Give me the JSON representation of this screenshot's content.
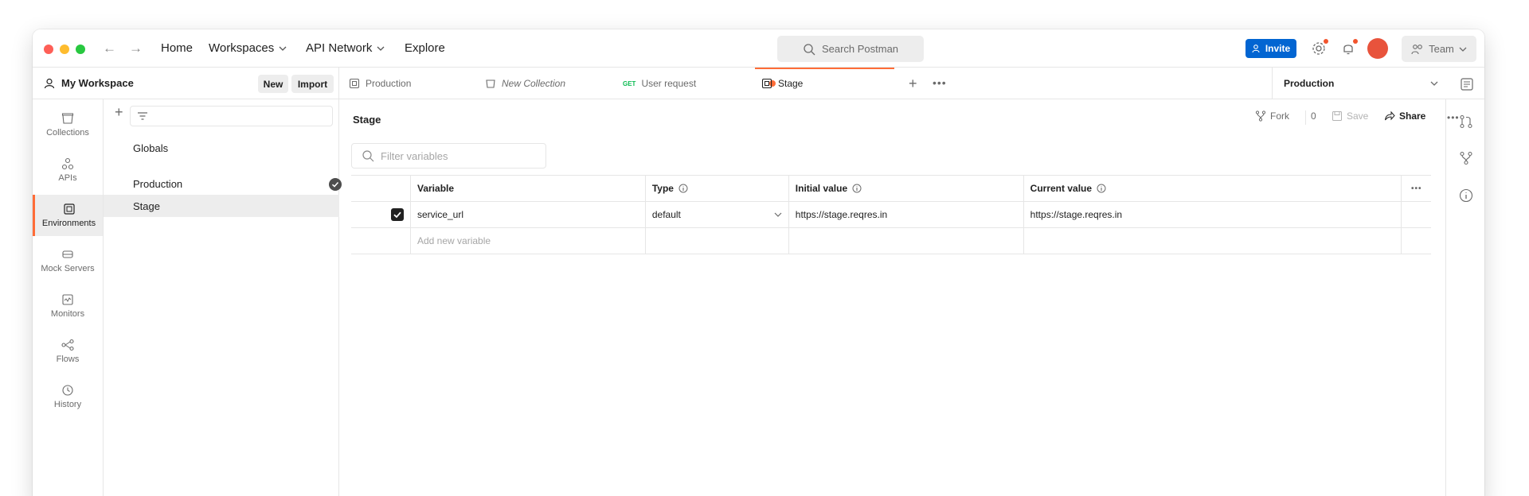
{
  "topbar": {
    "nav": {
      "home": "Home",
      "workspaces": "Workspaces",
      "api_network": "API Network",
      "explore": "Explore"
    },
    "search_placeholder": "Search Postman",
    "invite_label": "Invite",
    "team_label": "Team"
  },
  "workspace": {
    "title": "My Workspace",
    "new_label": "New",
    "import_label": "Import"
  },
  "tabs": [
    {
      "label": "Production",
      "icon": "environment-icon"
    },
    {
      "label": "New Collection",
      "icon": "collection-icon"
    },
    {
      "method": "GET",
      "label": "User request",
      "icon": "request-icon"
    },
    {
      "label": "Stage",
      "icon": "environment-icon",
      "active": true
    }
  ],
  "environment_selector": {
    "selected": "Production"
  },
  "sidebar": {
    "items": [
      {
        "label": "Collections",
        "icon": "collections-icon"
      },
      {
        "label": "APIs",
        "icon": "apis-icon"
      },
      {
        "label": "Environments",
        "icon": "environments-icon",
        "active": true
      },
      {
        "label": "Mock Servers",
        "icon": "mock-servers-icon"
      },
      {
        "label": "Monitors",
        "icon": "monitors-icon"
      },
      {
        "label": "Flows",
        "icon": "flows-icon"
      },
      {
        "label": "History",
        "icon": "history-icon"
      }
    ]
  },
  "env_list": {
    "globals": "Globals",
    "items": [
      {
        "label": "Production",
        "active_env": true
      },
      {
        "label": "Stage",
        "selected": true
      }
    ]
  },
  "main": {
    "title": "Stage",
    "fork_label": "Fork",
    "fork_count": "0",
    "save_label": "Save",
    "share_label": "Share",
    "filter_placeholder": "Filter variables",
    "columns": {
      "variable": "Variable",
      "type": "Type",
      "initial_value": "Initial value",
      "current_value": "Current value"
    },
    "rows": [
      {
        "enabled": true,
        "variable": "service_url",
        "type": "default",
        "initial_value": "https://stage.reqres.in",
        "current_value": "https://stage.reqres.in"
      }
    ],
    "add_placeholder": "Add new variable"
  },
  "colors": {
    "accent": "#ff6c37",
    "invite": "#0265d2",
    "notification": "#f2542d"
  }
}
